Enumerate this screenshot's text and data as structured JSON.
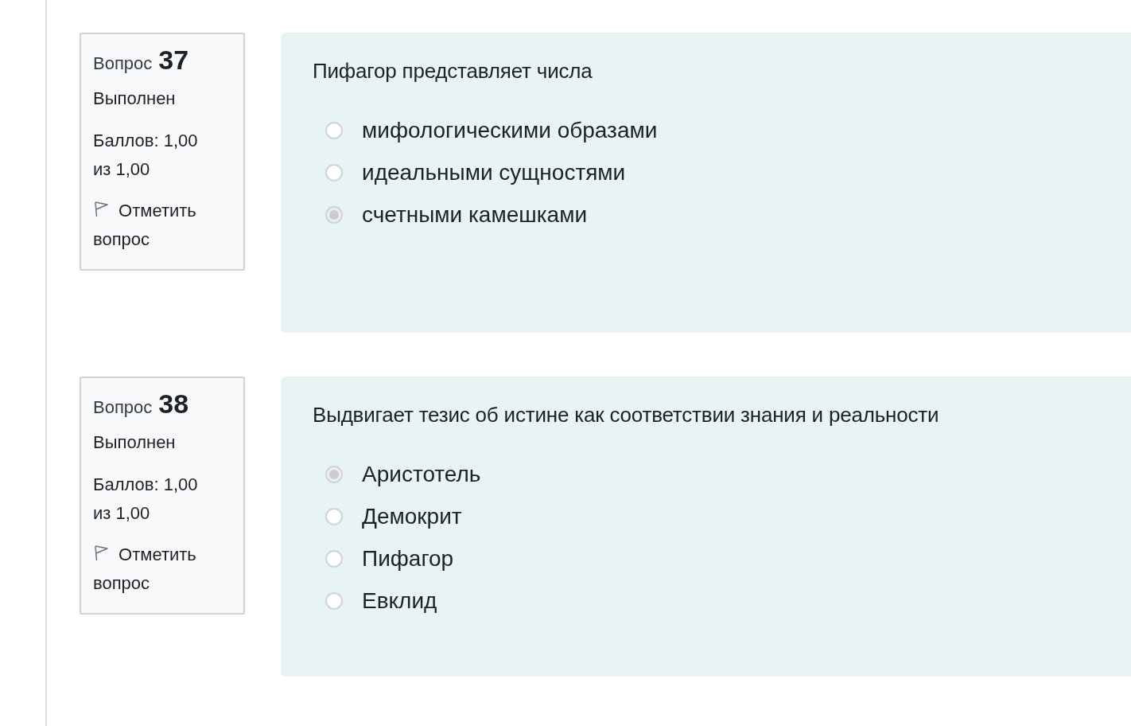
{
  "questions": [
    {
      "label": "Вопрос",
      "number": "37",
      "status": "Выполнен",
      "score": "Баллов: 1,00 из 1,00",
      "flag": "Отметить вопрос",
      "text": "Пифагор представляет числа",
      "options": [
        {
          "label": "мифологическими образами",
          "selected": false
        },
        {
          "label": "идеальными сущностями",
          "selected": false
        },
        {
          "label": "счетными камешками",
          "selected": true
        }
      ]
    },
    {
      "label": "Вопрос",
      "number": "38",
      "status": "Выполнен",
      "score": "Баллов: 1,00 из 1,00",
      "flag": "Отметить вопрос",
      "text": "Выдвигает тезис об истине как соответствии знания и реальности",
      "options": [
        {
          "label": "Аристотель",
          "selected": true
        },
        {
          "label": "Демокрит",
          "selected": false
        },
        {
          "label": "Пифагор",
          "selected": false
        },
        {
          "label": "Евклид",
          "selected": false
        }
      ]
    }
  ]
}
